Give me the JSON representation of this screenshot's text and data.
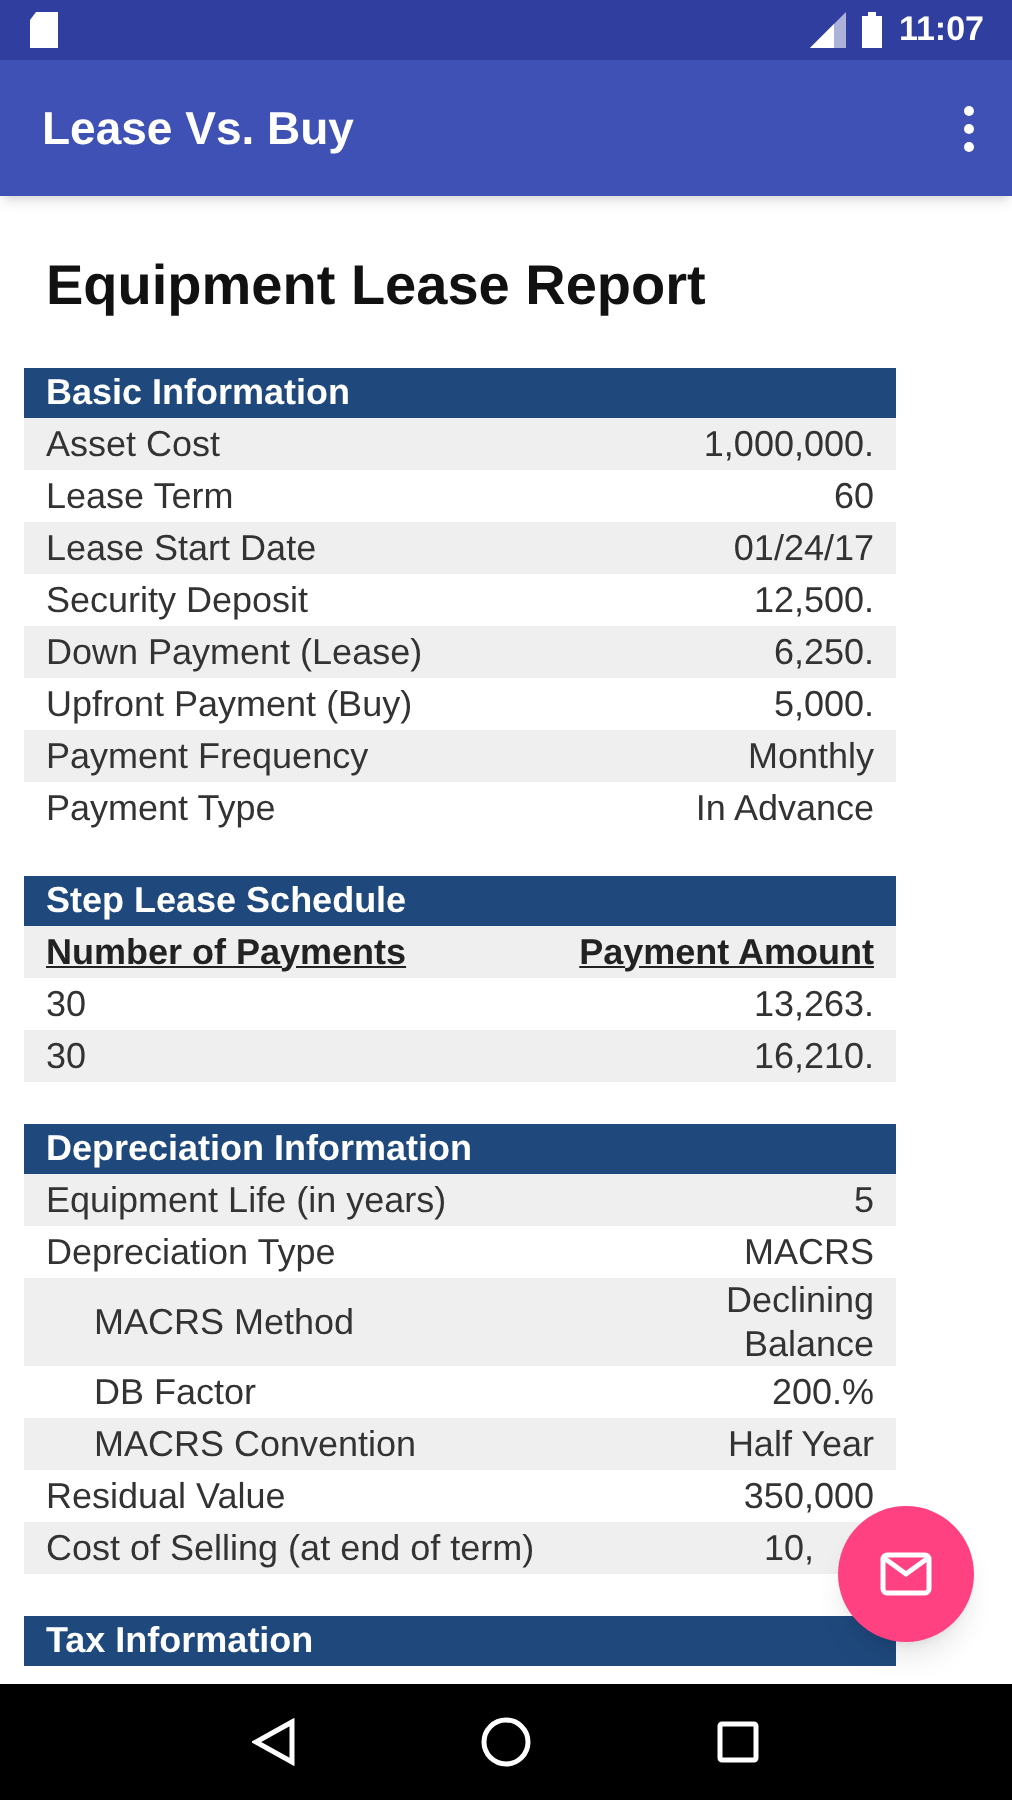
{
  "status_bar": {
    "time": "11:07"
  },
  "app_bar": {
    "title": "Lease Vs. Buy"
  },
  "report": {
    "title": "Equipment Lease Report",
    "sections": [
      {
        "kind": "pairs",
        "title": "Basic Information",
        "rows": [
          {
            "label": "Asset Cost",
            "value": "1,000,000."
          },
          {
            "label": "Lease Term",
            "value": "60"
          },
          {
            "label": "Lease Start Date",
            "value": "01/24/17"
          },
          {
            "label": "Security Deposit",
            "value": "12,500."
          },
          {
            "label": "Down Payment (Lease)",
            "value": "6,250."
          },
          {
            "label": "Upfront Payment (Buy)",
            "value": "5,000."
          },
          {
            "label": "Payment Frequency",
            "value": "Monthly"
          },
          {
            "label": "Payment Type",
            "value": "In Advance"
          }
        ]
      },
      {
        "kind": "table",
        "title": "Step Lease Schedule",
        "columns": [
          "Number of Payments",
          "Payment Amount"
        ],
        "rows": [
          [
            "30",
            "13,263."
          ],
          [
            "30",
            "16,210."
          ]
        ]
      },
      {
        "kind": "pairs",
        "title": "Depreciation Information",
        "rows": [
          {
            "label": "Equipment Life (in years)",
            "value": "5"
          },
          {
            "label": "Depreciation Type",
            "value": "MACRS",
            "children": [
              {
                "label": "MACRS Method",
                "value": "Declining Balance"
              },
              {
                "label": "DB Factor",
                "value": "200.%"
              },
              {
                "label": "MACRS Convention",
                "value": "Half Year"
              }
            ]
          },
          {
            "label": "Residual Value",
            "value": "350,000"
          },
          {
            "label": "Cost of Selling (at end of term)",
            "value": "10,"
          }
        ]
      },
      {
        "kind": "pairs",
        "title": "Tax Information"
      }
    ]
  }
}
